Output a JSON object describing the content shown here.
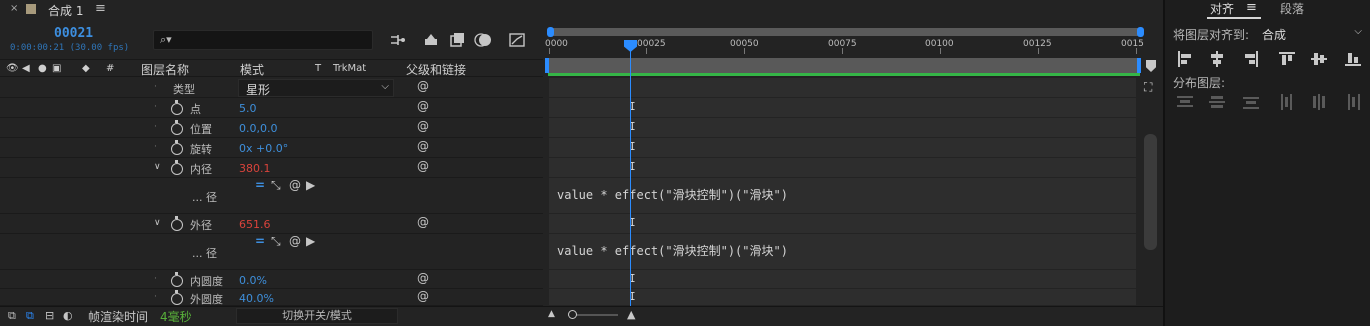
{
  "tab": {
    "close": "×",
    "name": "合成 1",
    "menu": "≡"
  },
  "header": {
    "timecode": "00021",
    "timecode_sub": "0:00:00:21 (30.00 fps)",
    "search_icon": "⌕▾"
  },
  "columns": {
    "layer_name": "图层名称",
    "mode": "模式",
    "t": "T",
    "trkmat": "TrkMat",
    "parent": "父级和链接",
    "hash": "#"
  },
  "rows": [
    {
      "label": "类型",
      "value": "星形"
    },
    {
      "label": "点",
      "value": "5.0"
    },
    {
      "label": "位置",
      "value": "0.0,0.0"
    },
    {
      "label": "旋转",
      "value": "0x +0.0°"
    },
    {
      "label": "内径",
      "value": "380.1"
    },
    {
      "label": "... 径"
    },
    {
      "label": "外径",
      "value": "651.6"
    },
    {
      "label": "... 径"
    },
    {
      "label": "内圆度",
      "value": "0.0%"
    },
    {
      "label": "外圆度",
      "value": "40.0%"
    }
  ],
  "expressions": {
    "inner": "value * effect(\"滑块控制\")(\"滑块\")",
    "outer": "value * effect(\"滑块控制\")(\"滑块\")"
  },
  "keyframe_marker": "I",
  "ruler": {
    "ticks": [
      "0000",
      "00025",
      "00050",
      "00075",
      "00100",
      "00125",
      "0015"
    ]
  },
  "bottom": {
    "render_label": "帧渲染时间",
    "render_value": "4毫秒",
    "toggle_button": "切换开关/模式"
  },
  "right_panel": {
    "tab_align": "对齐",
    "tab_menu": "≡",
    "tab_paragraph": "段落",
    "align_to_label": "将图层对齐到:",
    "align_to_value": "合成",
    "distribute_label": "分布图层:"
  },
  "colors": {
    "accent": "#2b8cff",
    "value_blue": "#3e8fdb",
    "value_red": "#d9433b",
    "workarea_green": "#35b547",
    "render_green": "#58b03a"
  }
}
